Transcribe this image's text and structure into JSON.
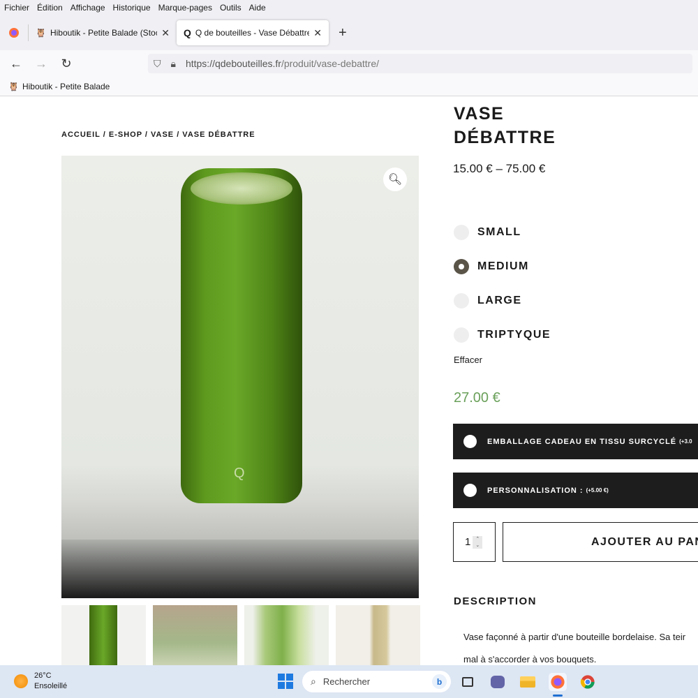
{
  "menubar": {
    "items": [
      "Fichier",
      "Édition",
      "Affichage",
      "Historique",
      "Marque-pages",
      "Outils",
      "Aide"
    ]
  },
  "tabs": [
    {
      "title": "Hiboutik - Petite Balade (Stock",
      "icon": "owl-icon"
    },
    {
      "title": "Q de bouteilles - Vase Débattre",
      "icon": "q-logo-icon"
    }
  ],
  "url": {
    "host": "https://qdebouteilles.fr",
    "path": "/produit/vase-debattre/"
  },
  "bookmarks": [
    {
      "label": "Hiboutik - Petite Balade",
      "icon": "owl-icon"
    }
  ],
  "page": {
    "breadcrumb": "ACCUEIL / E-SHOP / VASE / VASE DÉBATTRE",
    "title_line1": "VASE",
    "title_line2": "DÉBATTRE",
    "price_range": "15.00 € – 75.00 €",
    "sizes": [
      {
        "label": "SMALL",
        "selected": false
      },
      {
        "label": "MEDIUM",
        "selected": true
      },
      {
        "label": "LARGE",
        "selected": false
      },
      {
        "label": "TRIPTYQUE",
        "selected": false
      }
    ],
    "reset_label": "Effacer",
    "price": "27.00 €",
    "addons": [
      {
        "label": "EMBALLAGE CADEAU EN TISSU SURCYCLÉ",
        "extra": "(+3.0"
      },
      {
        "label": "PERSONNALISATION :",
        "extra": "(+5.00 €)"
      }
    ],
    "quantity": "1",
    "add_to_cart": "AJOUTER AU PAN",
    "description_title": "DESCRIPTION",
    "description_lines": [
      "Vase façonné à partir d'une bouteille bordelaise. Sa teir",
      "mal à s'accorder à vos bouquets."
    ],
    "price_color": "#6aa05a"
  },
  "taskbar": {
    "temperature": "26°C",
    "weather": "Ensoleillé",
    "search_placeholder": "Rechercher"
  }
}
